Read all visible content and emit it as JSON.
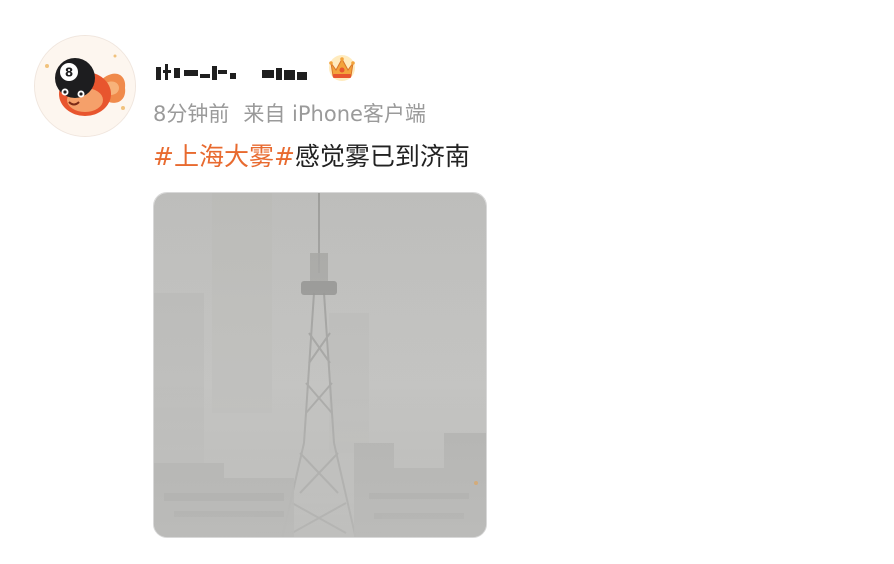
{
  "post": {
    "author": {
      "name": "",
      "badge_icon": "crown-icon",
      "avatar_icon": "billiard-8-ball-fish-icon"
    },
    "meta": {
      "time": "8分钟前",
      "source": "来自 iPhone客户端"
    },
    "content": {
      "hashtag": "#上海大雾#",
      "text": "感觉雾已到济南"
    },
    "photo": {
      "subject": "foggy-city-tv-tower"
    }
  },
  "colors": {
    "hashtag": "#e86a2f",
    "meta": "#9a9a9a",
    "text": "#222222"
  }
}
